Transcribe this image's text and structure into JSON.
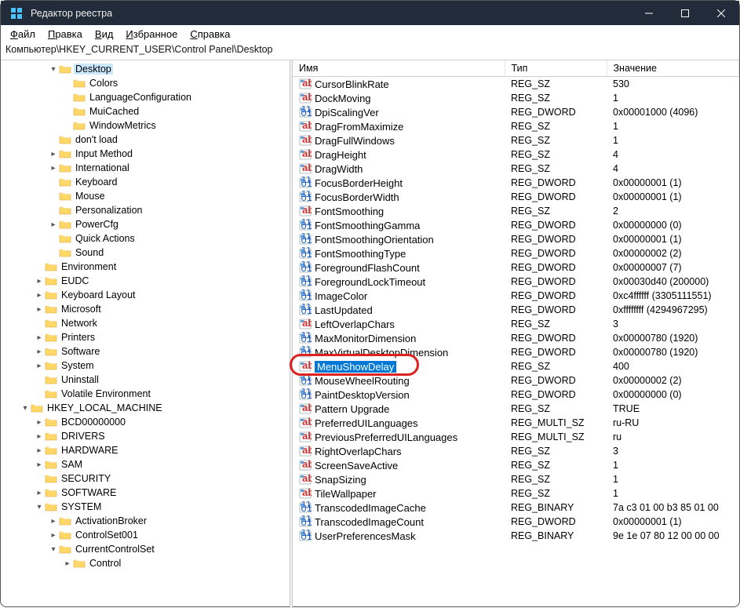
{
  "window": {
    "title": "Редактор реестра"
  },
  "menu": {
    "file": "Файл",
    "edit": "Правка",
    "view": "Вид",
    "favorites": "Избранное",
    "help": "Справка"
  },
  "address": "Компьютер\\HKEY_CURRENT_USER\\Control Panel\\Desktop",
  "tree": [
    {
      "d": 3,
      "exp": "open",
      "label": "Desktop",
      "sel": true
    },
    {
      "d": 4,
      "exp": "none",
      "label": "Colors"
    },
    {
      "d": 4,
      "exp": "none",
      "label": "LanguageConfiguration"
    },
    {
      "d": 4,
      "exp": "none",
      "label": "MuiCached"
    },
    {
      "d": 4,
      "exp": "none",
      "label": "WindowMetrics"
    },
    {
      "d": 3,
      "exp": "none",
      "label": "don't load"
    },
    {
      "d": 3,
      "exp": "closed",
      "label": "Input Method"
    },
    {
      "d": 3,
      "exp": "closed",
      "label": "International"
    },
    {
      "d": 3,
      "exp": "none",
      "label": "Keyboard"
    },
    {
      "d": 3,
      "exp": "none",
      "label": "Mouse"
    },
    {
      "d": 3,
      "exp": "none",
      "label": "Personalization"
    },
    {
      "d": 3,
      "exp": "closed",
      "label": "PowerCfg"
    },
    {
      "d": 3,
      "exp": "none",
      "label": "Quick Actions"
    },
    {
      "d": 3,
      "exp": "none",
      "label": "Sound"
    },
    {
      "d": 2,
      "exp": "none",
      "label": "Environment"
    },
    {
      "d": 2,
      "exp": "closed",
      "label": "EUDC"
    },
    {
      "d": 2,
      "exp": "closed",
      "label": "Keyboard Layout"
    },
    {
      "d": 2,
      "exp": "closed",
      "label": "Microsoft"
    },
    {
      "d": 2,
      "exp": "none",
      "label": "Network"
    },
    {
      "d": 2,
      "exp": "closed",
      "label": "Printers"
    },
    {
      "d": 2,
      "exp": "closed",
      "label": "Software"
    },
    {
      "d": 2,
      "exp": "closed",
      "label": "System"
    },
    {
      "d": 2,
      "exp": "none",
      "label": "Uninstall"
    },
    {
      "d": 2,
      "exp": "none",
      "label": "Volatile Environment"
    },
    {
      "d": 1,
      "exp": "open",
      "label": "HKEY_LOCAL_MACHINE"
    },
    {
      "d": 2,
      "exp": "closed",
      "label": "BCD00000000"
    },
    {
      "d": 2,
      "exp": "closed",
      "label": "DRIVERS"
    },
    {
      "d": 2,
      "exp": "closed",
      "label": "HARDWARE"
    },
    {
      "d": 2,
      "exp": "closed",
      "label": "SAM"
    },
    {
      "d": 2,
      "exp": "none",
      "label": "SECURITY"
    },
    {
      "d": 2,
      "exp": "closed",
      "label": "SOFTWARE"
    },
    {
      "d": 2,
      "exp": "open",
      "label": "SYSTEM"
    },
    {
      "d": 3,
      "exp": "closed",
      "label": "ActivationBroker"
    },
    {
      "d": 3,
      "exp": "closed",
      "label": "ControlSet001"
    },
    {
      "d": 3,
      "exp": "open",
      "label": "CurrentControlSet"
    },
    {
      "d": 4,
      "exp": "closed",
      "label": "Control"
    }
  ],
  "columns": {
    "name": "Имя",
    "type": "Тип",
    "data": "Значение"
  },
  "values": [
    {
      "icon": "sz",
      "name": "CursorBlinkRate",
      "type": "REG_SZ",
      "data": "530"
    },
    {
      "icon": "sz",
      "name": "DockMoving",
      "type": "REG_SZ",
      "data": "1"
    },
    {
      "icon": "bin",
      "name": "DpiScalingVer",
      "type": "REG_DWORD",
      "data": "0x00001000 (4096)"
    },
    {
      "icon": "sz",
      "name": "DragFromMaximize",
      "type": "REG_SZ",
      "data": "1"
    },
    {
      "icon": "sz",
      "name": "DragFullWindows",
      "type": "REG_SZ",
      "data": "1"
    },
    {
      "icon": "sz",
      "name": "DragHeight",
      "type": "REG_SZ",
      "data": "4"
    },
    {
      "icon": "sz",
      "name": "DragWidth",
      "type": "REG_SZ",
      "data": "4"
    },
    {
      "icon": "bin",
      "name": "FocusBorderHeight",
      "type": "REG_DWORD",
      "data": "0x00000001 (1)"
    },
    {
      "icon": "bin",
      "name": "FocusBorderWidth",
      "type": "REG_DWORD",
      "data": "0x00000001 (1)"
    },
    {
      "icon": "sz",
      "name": "FontSmoothing",
      "type": "REG_SZ",
      "data": "2"
    },
    {
      "icon": "bin",
      "name": "FontSmoothingGamma",
      "type": "REG_DWORD",
      "data": "0x00000000 (0)"
    },
    {
      "icon": "bin",
      "name": "FontSmoothingOrientation",
      "type": "REG_DWORD",
      "data": "0x00000001 (1)"
    },
    {
      "icon": "bin",
      "name": "FontSmoothingType",
      "type": "REG_DWORD",
      "data": "0x00000002 (2)"
    },
    {
      "icon": "bin",
      "name": "ForegroundFlashCount",
      "type": "REG_DWORD",
      "data": "0x00000007 (7)"
    },
    {
      "icon": "bin",
      "name": "ForegroundLockTimeout",
      "type": "REG_DWORD",
      "data": "0x00030d40 (200000)"
    },
    {
      "icon": "bin",
      "name": "ImageColor",
      "type": "REG_DWORD",
      "data": "0xc4ffffff (3305111551)"
    },
    {
      "icon": "bin",
      "name": "LastUpdated",
      "type": "REG_DWORD",
      "data": "0xffffffff (4294967295)"
    },
    {
      "icon": "sz",
      "name": "LeftOverlapChars",
      "type": "REG_SZ",
      "data": "3"
    },
    {
      "icon": "bin",
      "name": "MaxMonitorDimension",
      "type": "REG_DWORD",
      "data": "0x00000780 (1920)"
    },
    {
      "icon": "bin",
      "name": "MaxVirtualDesktopDimension",
      "type": "REG_DWORD",
      "data": "0x00000780 (1920)"
    },
    {
      "icon": "sz",
      "name": "MenuShowDelay",
      "type": "REG_SZ",
      "data": "400",
      "hl": true
    },
    {
      "icon": "bin",
      "name": "MouseWheelRouting",
      "type": "REG_DWORD",
      "data": "0x00000002 (2)"
    },
    {
      "icon": "bin",
      "name": "PaintDesktopVersion",
      "type": "REG_DWORD",
      "data": "0x00000000 (0)"
    },
    {
      "icon": "sz",
      "name": "Pattern Upgrade",
      "type": "REG_SZ",
      "data": "TRUE"
    },
    {
      "icon": "sz",
      "name": "PreferredUILanguages",
      "type": "REG_MULTI_SZ",
      "data": "ru-RU"
    },
    {
      "icon": "sz",
      "name": "PreviousPreferredUILanguages",
      "type": "REG_MULTI_SZ",
      "data": "ru"
    },
    {
      "icon": "sz",
      "name": "RightOverlapChars",
      "type": "REG_SZ",
      "data": "3"
    },
    {
      "icon": "sz",
      "name": "ScreenSaveActive",
      "type": "REG_SZ",
      "data": "1"
    },
    {
      "icon": "sz",
      "name": "SnapSizing",
      "type": "REG_SZ",
      "data": "1"
    },
    {
      "icon": "sz",
      "name": "TileWallpaper",
      "type": "REG_SZ",
      "data": "1"
    },
    {
      "icon": "bin",
      "name": "TranscodedImageCache",
      "type": "REG_BINARY",
      "data": "7a c3 01 00 b3 85 01 00"
    },
    {
      "icon": "bin",
      "name": "TranscodedImageCount",
      "type": "REG_DWORD",
      "data": "0x00000001 (1)"
    },
    {
      "icon": "bin",
      "name": "UserPreferencesMask",
      "type": "REG_BINARY",
      "data": "9e 1e 07 80 12 00 00 00"
    }
  ]
}
